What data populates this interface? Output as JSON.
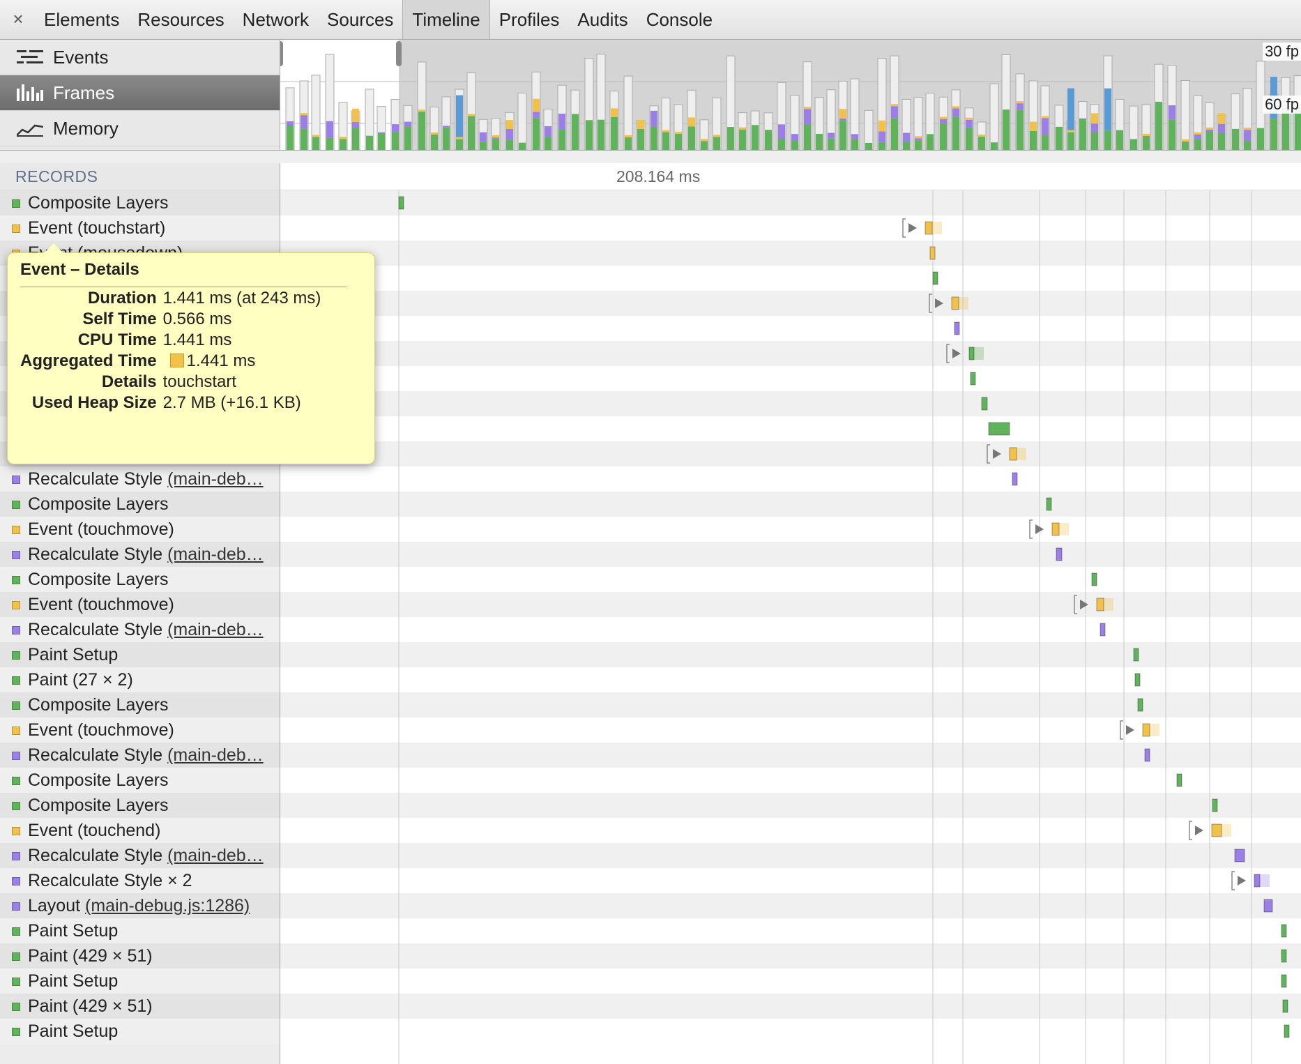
{
  "toolbar": {
    "close_glyph": "×",
    "tabs": [
      "Elements",
      "Resources",
      "Network",
      "Sources",
      "Timeline",
      "Profiles",
      "Audits",
      "Console"
    ],
    "active_tab": "Timeline"
  },
  "overview": {
    "items": [
      {
        "label": "Events",
        "icon": "events-icon"
      },
      {
        "label": "Frames",
        "icon": "frames-icon",
        "selected": true
      },
      {
        "label": "Memory",
        "icon": "memory-icon"
      }
    ],
    "fps_labels": [
      "30 fp",
      "60 fp"
    ]
  },
  "records": {
    "header": "RECORDS",
    "duration": "208.164 ms",
    "rows": [
      {
        "name": "Composite Layers",
        "color": "#5fb35a"
      },
      {
        "name": "Event (touchstart)",
        "color": "#f1c14a"
      },
      {
        "name": "Event (mousedown)",
        "color": "#f1c14a"
      },
      {
        "name": "",
        "color": ""
      },
      {
        "name": "",
        "color": ""
      },
      {
        "name": "",
        "color": ""
      },
      {
        "name": "",
        "color": ""
      },
      {
        "name": "",
        "color": ""
      },
      {
        "name": "",
        "color": ""
      },
      {
        "name": "",
        "color": ""
      },
      {
        "name": "",
        "color": ""
      },
      {
        "name": "Recalculate Style",
        "link": "(main-deb…",
        "color": "#9b7fe6"
      },
      {
        "name": "Composite Layers",
        "color": "#5fb35a"
      },
      {
        "name": "Event (touchmove)",
        "color": "#f1c14a"
      },
      {
        "name": "Recalculate Style",
        "link": "(main-deb…",
        "color": "#9b7fe6"
      },
      {
        "name": "Composite Layers",
        "color": "#5fb35a"
      },
      {
        "name": "Event (touchmove)",
        "color": "#f1c14a"
      },
      {
        "name": "Recalculate Style",
        "link": "(main-deb…",
        "color": "#9b7fe6"
      },
      {
        "name": "Paint Setup",
        "color": "#5fb35a"
      },
      {
        "name": "Paint (27 × 2)",
        "color": "#5fb35a"
      },
      {
        "name": "Composite Layers",
        "color": "#5fb35a"
      },
      {
        "name": "Event (touchmove)",
        "color": "#f1c14a"
      },
      {
        "name": "Recalculate Style",
        "link": "(main-deb…",
        "color": "#9b7fe6"
      },
      {
        "name": "Composite Layers",
        "color": "#5fb35a"
      },
      {
        "name": "Composite Layers",
        "color": "#5fb35a"
      },
      {
        "name": "Event (touchend)",
        "color": "#f1c14a"
      },
      {
        "name": "Recalculate Style",
        "link": "(main-deb…",
        "color": "#9b7fe6"
      },
      {
        "name": "Recalculate Style × 2",
        "color": "#9b7fe6"
      },
      {
        "name": "Layout",
        "link": "(main-debug.js:1286)",
        "color": "#9b7fe6"
      },
      {
        "name": "Paint Setup",
        "color": "#5fb35a"
      },
      {
        "name": "Paint (429 × 51)",
        "color": "#5fb35a"
      },
      {
        "name": "Paint Setup",
        "color": "#5fb35a"
      },
      {
        "name": "Paint (429 × 51)",
        "color": "#5fb35a"
      },
      {
        "name": "Paint Setup",
        "color": "#5fb35a"
      }
    ]
  },
  "popover": {
    "title": "Event – Details",
    "rows": [
      {
        "key": "Duration",
        "value": "1.441 ms (at 243 ms)"
      },
      {
        "key": "Self Time",
        "value": "0.566 ms"
      },
      {
        "key": "CPU Time",
        "value": "1.441 ms"
      },
      {
        "key": "Aggregated Time",
        "value": "1.441 ms",
        "swatch": true
      },
      {
        "key": "Details",
        "value": "touchstart"
      },
      {
        "key": "Used Heap Size",
        "value": "2.7 MB (+16.1 KB)"
      }
    ]
  },
  "colors": {
    "scripting": "#f1c14a",
    "rendering": "#9b7fe6",
    "painting": "#5fb35a",
    "loading": "#5b9bd5",
    "idle": "#e6e6e6"
  }
}
